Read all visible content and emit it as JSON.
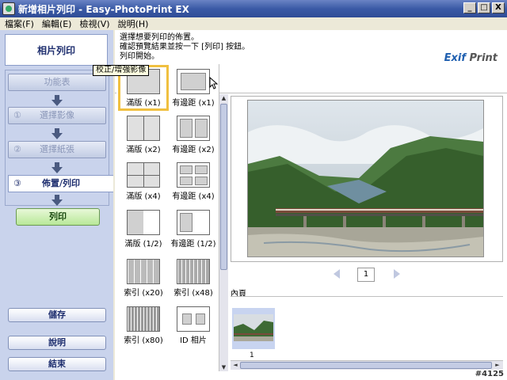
{
  "window": {
    "title": "新增相片列印 - Easy-PhotoPrint EX",
    "buttons": [
      "_",
      "□",
      "X"
    ]
  },
  "menu": [
    "檔案(F)",
    "編輯(E)",
    "檢視(V)",
    "說明(H)"
  ],
  "sidebar": {
    "header": "相片列印",
    "steps": [
      {
        "num": "",
        "label": "功能表"
      },
      {
        "num": "①",
        "label": "選擇影像"
      },
      {
        "num": "②",
        "label": "選擇紙張"
      }
    ],
    "active_step": {
      "num": "③",
      "label": "佈置/列印"
    },
    "print_button": "列印",
    "save_button": "儲存",
    "help_button": "說明",
    "exit_button": "結束"
  },
  "instructions": [
    "選擇想要列印的佈置。",
    "確認預覽結果並按一下 [列印] 按鈕。",
    "列印開始。"
  ],
  "logo": {
    "prefix": "Exif",
    "suffix": " Print"
  },
  "toolbar": {
    "icons": [
      "rotate-left-icon",
      "rotate-right-icon",
      "crop-icon",
      "date-icon",
      "correct-enhance-icon"
    ],
    "tooltip": "校正/增強影像"
  },
  "layouts": [
    {
      "label": "滿版 (x1)",
      "selected": true
    },
    {
      "label": "有邊距 (x1)",
      "selected": false
    },
    {
      "label": "滿版 (x2)",
      "selected": false
    },
    {
      "label": "有邊距 (x2)",
      "selected": false
    },
    {
      "label": "滿版 (x4)",
      "selected": false
    },
    {
      "label": "有邊距 (x4)",
      "selected": false
    },
    {
      "label": "滿版 (1/2)",
      "selected": false
    },
    {
      "label": "有邊距 (1/2)",
      "selected": false
    },
    {
      "label": "索引 (x20)",
      "selected": false
    },
    {
      "label": "索引 (x48)",
      "selected": false
    },
    {
      "label": "索引 (x80)",
      "selected": false
    },
    {
      "label": "ID 相片",
      "selected": false
    }
  ],
  "preview": {
    "page_number": "1"
  },
  "contents": {
    "label": "內頁",
    "thumb_number": "1"
  },
  "watermark": "#4125",
  "colors": {
    "titlebar": "#3b5aa6",
    "sidebar": "#c9d3ec",
    "selection": "#f0c040",
    "print_button": "#b8e898"
  }
}
